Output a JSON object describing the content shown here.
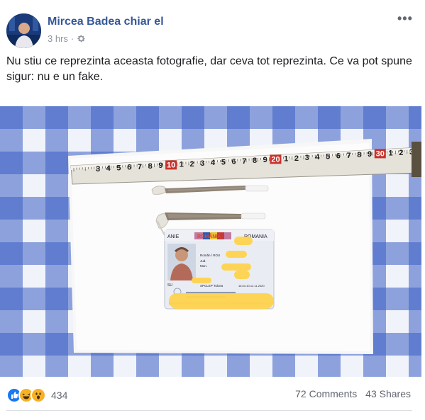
{
  "post": {
    "author": "Mircea Badea chiar el",
    "time": "3 hrs",
    "separator": "·",
    "more_label": "•••",
    "text": "Nu stiu ce reprezinta aceasta fotografie, dar ceva tot reprezinta. Ce va pot spune sigur: nu e un fake."
  },
  "photo": {
    "tape_numbers": [
      "3",
      "4",
      "5",
      "6",
      "7",
      "8",
      "9",
      "10",
      "1",
      "2",
      "3",
      "4",
      "5",
      "6",
      "7",
      "8",
      "9",
      "20",
      "1",
      "2",
      "3",
      "4",
      "5",
      "6",
      "7",
      "8",
      "9",
      "30",
      "1",
      "2",
      "3"
    ],
    "id_card": {
      "header_left": "ANIE",
      "header_middle": "ROMÂNIA",
      "header_right": "ROMANIA",
      "line1": "Romăn / ROU",
      "line2": "Jud.",
      "line3": "Mun.",
      "line4": "SPCLEP Tulcea",
      "line5": "16.04.10-12.11.2020",
      "side_code": "SU"
    }
  },
  "footer": {
    "reaction_count": "434",
    "comments": "72 Comments",
    "shares": "43 Shares"
  },
  "colors": {
    "link": "#365899",
    "like_blue": "#1877f2",
    "haha_yellow": "#f7b125",
    "check_blue": "#2a4cbf"
  }
}
